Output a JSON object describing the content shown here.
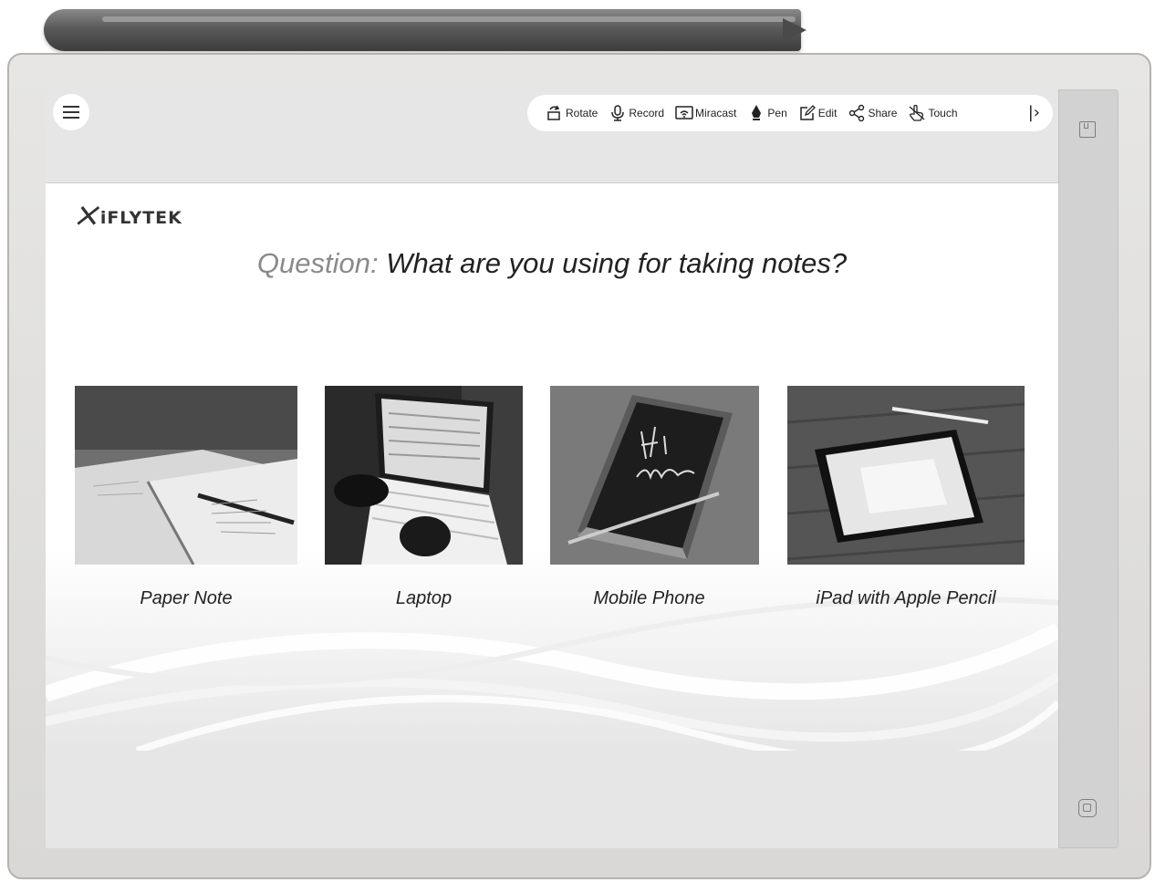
{
  "toolbar": {
    "items": [
      {
        "label": "Rotate",
        "icon": "rotate-icon"
      },
      {
        "label": "Record",
        "icon": "microphone-icon"
      },
      {
        "label": "Miracast",
        "icon": "cast-icon"
      },
      {
        "label": "Pen",
        "icon": "pen-icon"
      },
      {
        "label": "Edit",
        "icon": "edit-icon"
      },
      {
        "label": "Share",
        "icon": "share-icon"
      },
      {
        "label": "Touch",
        "icon": "touch-icon"
      }
    ],
    "collapse_glyph": "|›"
  },
  "slide": {
    "logo_text": "iFLYTEK",
    "question_label": "Question:",
    "question_text": "What are you using for taking notes?",
    "options": [
      {
        "caption": "Paper Note"
      },
      {
        "caption": "Laptop"
      },
      {
        "caption": "Mobile Phone"
      },
      {
        "caption": "iPad with Apple Pencil"
      }
    ]
  }
}
